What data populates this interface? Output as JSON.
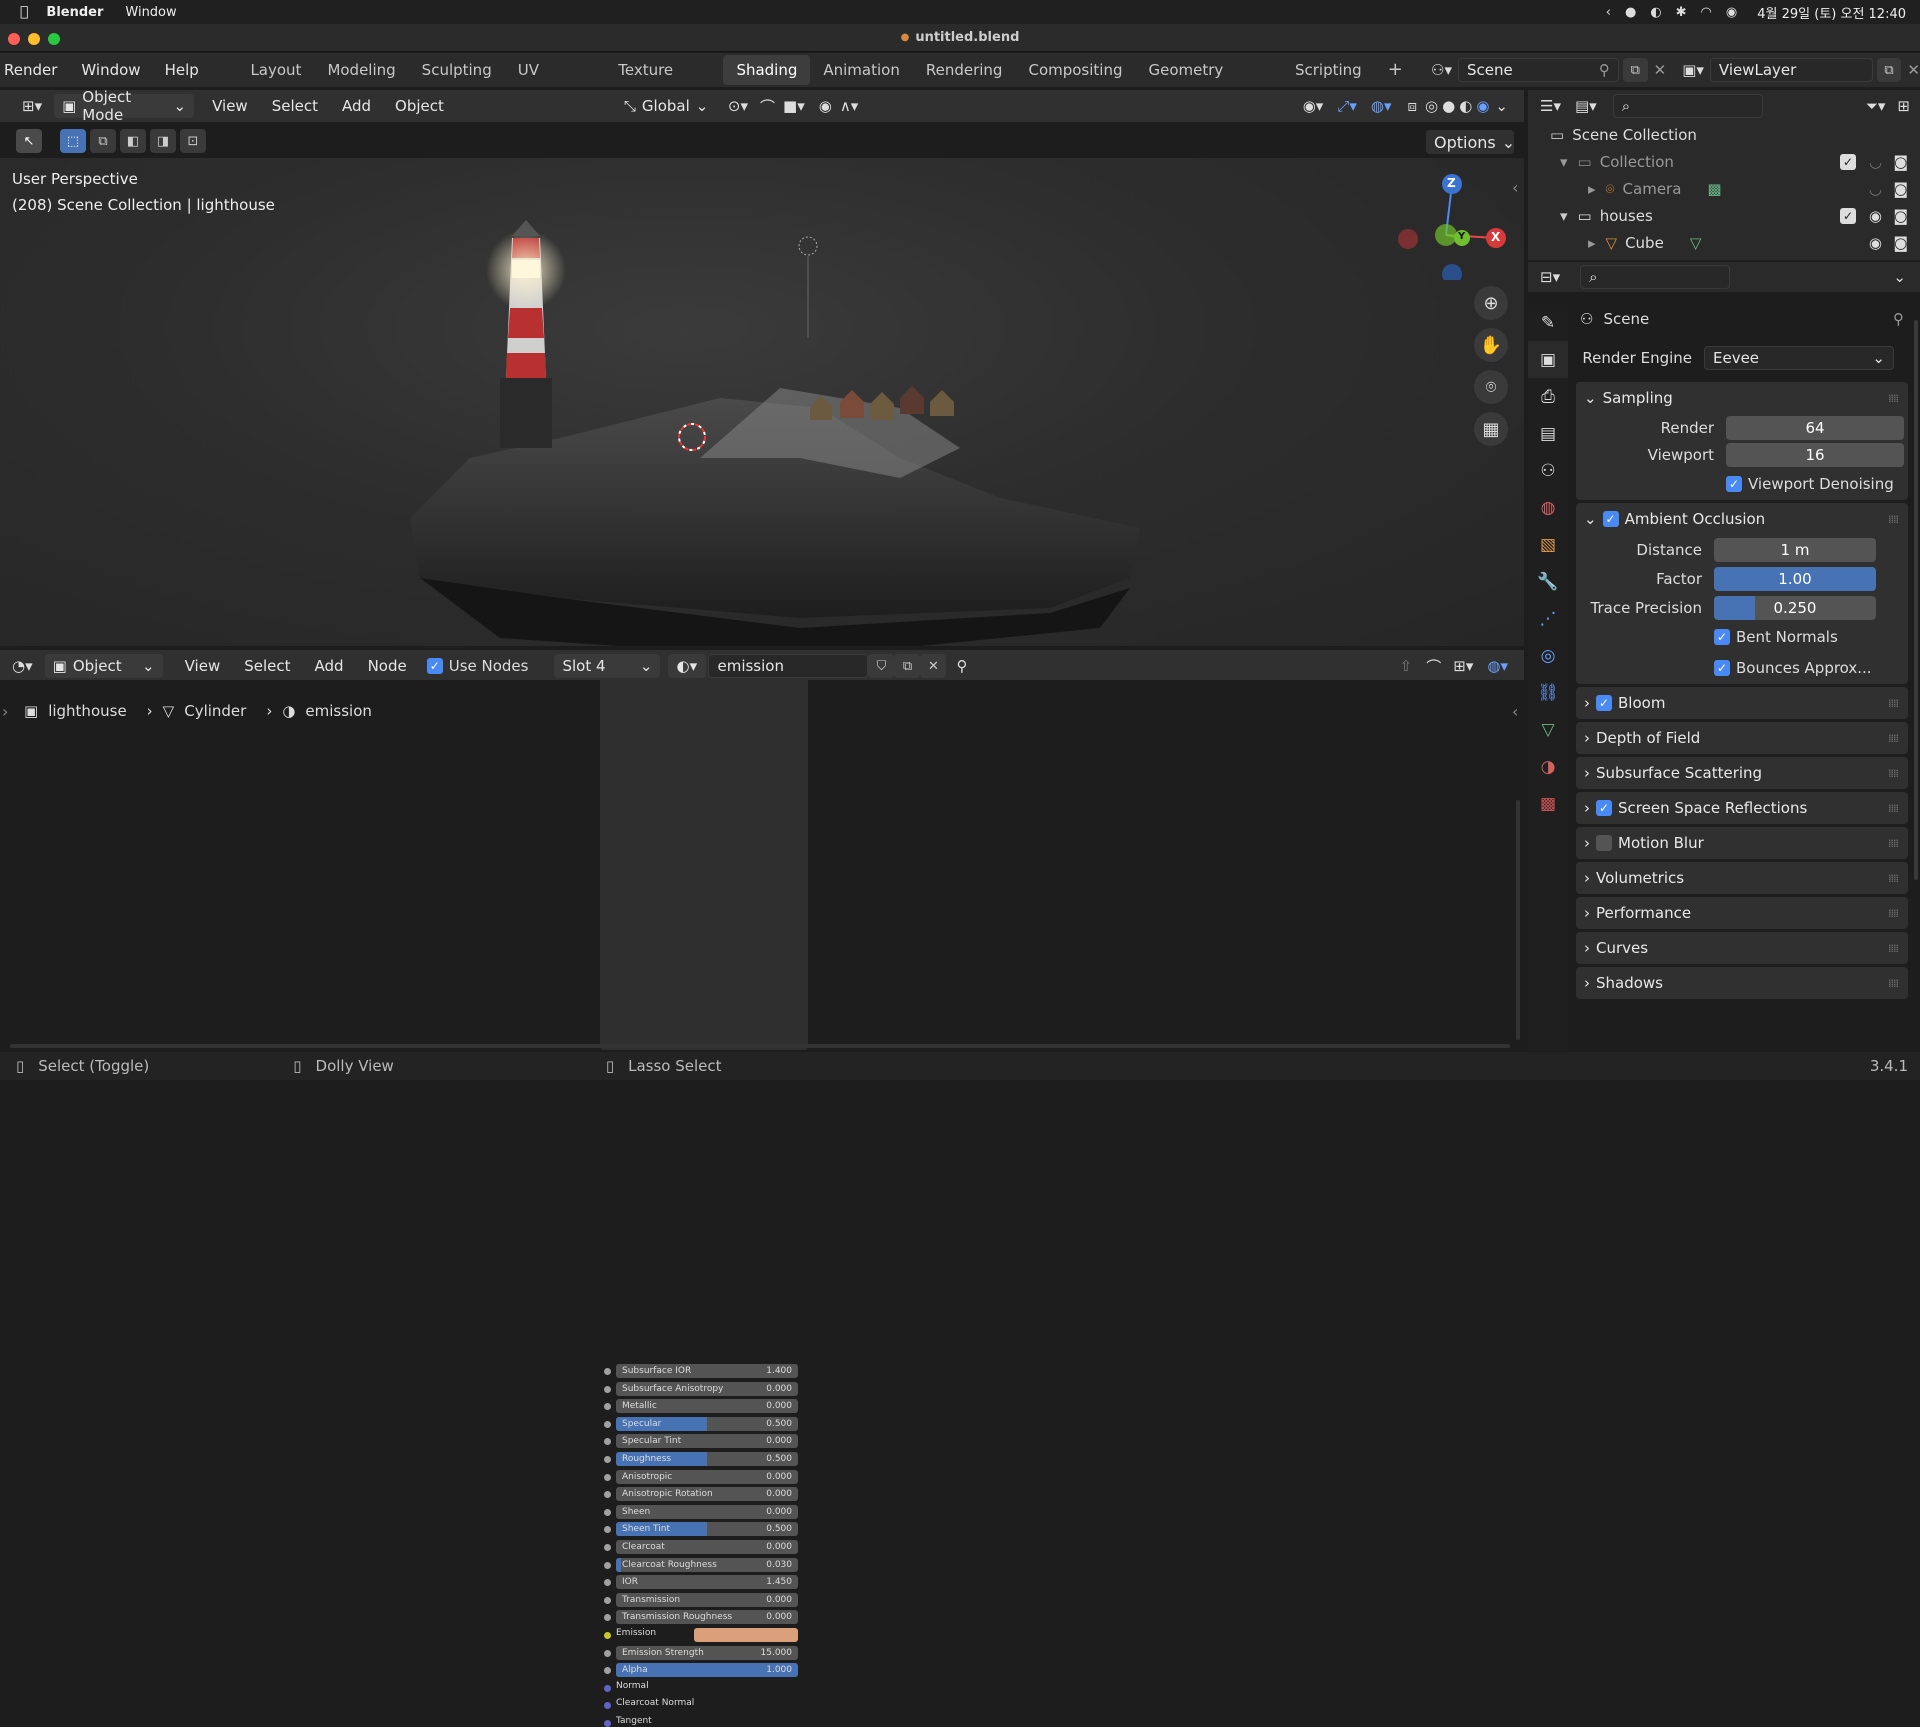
{
  "mac": {
    "app": "Blender",
    "window": "Window",
    "clock": "4월 29일 (토) 오전 12:40"
  },
  "title": "untitled.blend",
  "topbar": {
    "menus": [
      "Render",
      "Window",
      "Help"
    ],
    "workspaces": [
      "Layout",
      "Modeling",
      "Sculpting",
      "UV Editing",
      "Texture Paint",
      "Shading",
      "Animation",
      "Rendering",
      "Compositing",
      "Geometry Nodes",
      "Scripting"
    ],
    "add": "+",
    "scene": "Scene",
    "viewlayer": "ViewLayer"
  },
  "vp_header": {
    "mode": "Object Mode",
    "menus": [
      "View",
      "Select",
      "Add",
      "Object"
    ],
    "orientation": "Global",
    "options": "Options"
  },
  "viewport": {
    "perspective": "User Perspective",
    "info": "(208) Scene Collection | lighthouse",
    "axes": {
      "z": "Z",
      "y": "Y",
      "x": "X"
    }
  },
  "node_header": {
    "editor": "Object",
    "menus": [
      "View",
      "Select",
      "Add",
      "Node"
    ],
    "use_nodes": "Use Nodes",
    "slot": "Slot 4",
    "material": "emission"
  },
  "breadcrumb": {
    "object": "lighthouse",
    "mesh": "Cylinder",
    "material": "emission"
  },
  "node_rows": [
    {
      "label": "Subsurface IOR",
      "value": "1.400",
      "fill": 0
    },
    {
      "label": "Subsurface Anisotropy",
      "value": "0.000",
      "fill": 0
    },
    {
      "label": "Metallic",
      "value": "0.000",
      "fill": 0
    },
    {
      "label": "Specular",
      "value": "0.500",
      "fill": 0.5
    },
    {
      "label": "Specular Tint",
      "value": "0.000",
      "fill": 0
    },
    {
      "label": "Roughness",
      "value": "0.500",
      "fill": 0.5
    },
    {
      "label": "Anisotropic",
      "value": "0.000",
      "fill": 0
    },
    {
      "label": "Anisotropic Rotation",
      "value": "0.000",
      "fill": 0
    },
    {
      "label": "Sheen",
      "value": "0.000",
      "fill": 0
    },
    {
      "label": "Sheen Tint",
      "value": "0.500",
      "fill": 0.5
    },
    {
      "label": "Clearcoat",
      "value": "0.000",
      "fill": 0
    },
    {
      "label": "Clearcoat Roughness",
      "value": "0.030",
      "fill": 0.03
    },
    {
      "label": "IOR",
      "value": "1.450",
      "fill": 0
    },
    {
      "label": "Transmission",
      "value": "0.000",
      "fill": 0
    },
    {
      "label": "Transmission Roughness",
      "value": "0.000",
      "fill": 0
    },
    {
      "label": "Emission",
      "value": "",
      "fill": 0,
      "color": "#d9a07a"
    },
    {
      "label": "Emission Strength",
      "value": "15.000",
      "fill": 0
    },
    {
      "label": "Alpha",
      "value": "1.000",
      "fill": 1
    },
    {
      "label": "Normal",
      "value": "",
      "fill": 0,
      "plain": true
    },
    {
      "label": "Clearcoat Normal",
      "value": "",
      "fill": 0,
      "plain": true
    },
    {
      "label": "Tangent",
      "value": "",
      "fill": 0,
      "plain": true
    }
  ],
  "outliner": {
    "root": "Scene Collection",
    "items": [
      {
        "name": "Collection"
      },
      {
        "name": "Camera"
      },
      {
        "name": "houses"
      },
      {
        "name": "Cube"
      }
    ]
  },
  "props": {
    "title": "Scene",
    "render_engine_label": "Render Engine",
    "render_engine": "Eevee",
    "sampling": {
      "title": "Sampling",
      "render_label": "Render",
      "render": "64",
      "viewport_label": "Viewport",
      "viewport": "16",
      "denoise": "Viewport Denoising"
    },
    "ao": {
      "title": "Ambient Occlusion",
      "distance_label": "Distance",
      "distance": "1 m",
      "factor_label": "Factor",
      "factor": "1.00",
      "factor_fill": 1,
      "trace_label": "Trace Precision",
      "trace": "0.250",
      "trace_fill": 0.25,
      "bent": "Bent Normals",
      "bounces": "Bounces Approx..."
    },
    "panels": [
      {
        "name": "Bloom",
        "check": true
      },
      {
        "name": "Depth of Field"
      },
      {
        "name": "Subsurface Scattering"
      },
      {
        "name": "Screen Space Reflections",
        "check": true
      },
      {
        "name": "Motion Blur",
        "check": false
      },
      {
        "name": "Volumetrics"
      },
      {
        "name": "Performance"
      },
      {
        "name": "Curves"
      },
      {
        "name": "Shadows"
      }
    ]
  },
  "status": {
    "select": "Select (Toggle)",
    "dolly": "Dolly View",
    "lasso": "Lasso Select",
    "version": "3.4.1"
  }
}
